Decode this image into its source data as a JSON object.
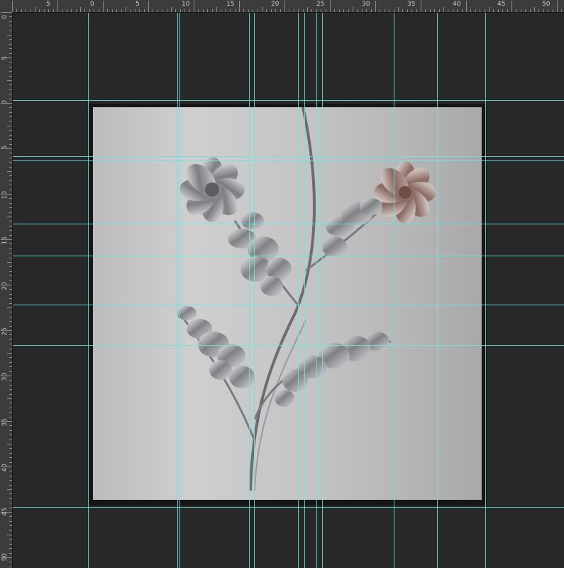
{
  "ruler": {
    "horizontal_labels": [
      "5",
      "0",
      "5",
      "10",
      "15",
      "20",
      "25",
      "30",
      "35",
      "40",
      "45",
      "50"
    ],
    "vertical_labels": [
      "0",
      "5",
      "0",
      "5",
      "10",
      "15",
      "20",
      "25",
      "30",
      "35",
      "40",
      "45",
      "50"
    ]
  },
  "document": {
    "guide_color": "#6fe3e3",
    "background_color": "#282828"
  },
  "artwork": {
    "description_icon": "metal-flower-wall-art"
  }
}
